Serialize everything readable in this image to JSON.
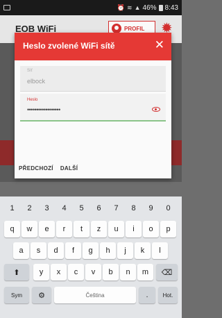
{
  "status_bar": {
    "battery": "46%",
    "time": "8:43"
  },
  "app": {
    "title": "EOB WiFi",
    "profile_label": "PROFIL"
  },
  "dialog": {
    "title": "Heslo zvolené WiFi sítě",
    "ssid_label": "Síť",
    "ssid_value": "elbock",
    "password_label": "Heslo",
    "password_value": "••••••••••••••••••",
    "prev_label": "PŘEDCHOZÍ",
    "next_label": "DALŠÍ"
  },
  "keyboard": {
    "numbers": [
      "1",
      "2",
      "3",
      "4",
      "5",
      "6",
      "7",
      "8",
      "9",
      "0"
    ],
    "row1": [
      "q",
      "w",
      "e",
      "r",
      "t",
      "z",
      "u",
      "i",
      "o",
      "p"
    ],
    "row2": [
      "a",
      "s",
      "d",
      "f",
      "g",
      "h",
      "j",
      "k",
      "l"
    ],
    "row3": [
      "y",
      "x",
      "c",
      "v",
      "b",
      "n",
      "m"
    ],
    "sym_label": "Sym",
    "space_label": "Čeština",
    "period_label": ".",
    "done_label": "Hot."
  },
  "colors": {
    "accent": "#e53935",
    "accent_dark": "#d32f2f",
    "field_underline": "#8bc48a"
  }
}
